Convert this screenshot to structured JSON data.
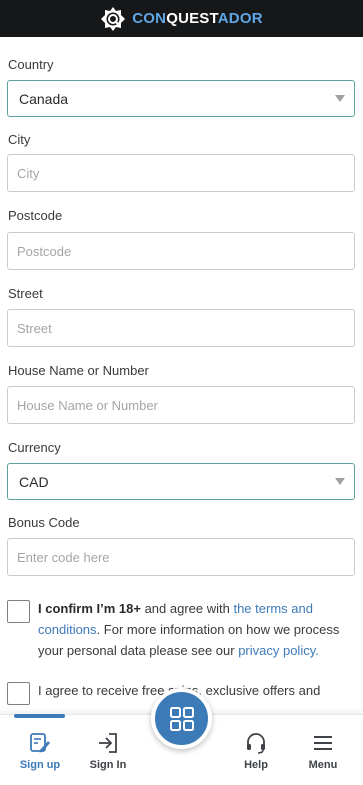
{
  "brand": {
    "logo_con": "CON",
    "logo_quest": "QUEST",
    "logo_ador": "ADOR"
  },
  "form": {
    "country": {
      "label": "Country",
      "value": "Canada"
    },
    "city": {
      "label": "City",
      "placeholder": "City"
    },
    "postcode": {
      "label": "Postcode",
      "placeholder": "Postcode"
    },
    "street": {
      "label": "Street",
      "placeholder": "Street"
    },
    "house": {
      "label": "House Name or Number",
      "placeholder": "House Name or Number"
    },
    "currency": {
      "label": "Currency",
      "value": "CAD"
    },
    "bonus": {
      "label": "Bonus Code",
      "placeholder": "Enter code here"
    }
  },
  "consent": {
    "age_bold": "I confirm I’m 18+",
    "age_text_1": " and agree with ",
    "age_link_terms": "the terms and conditions",
    "age_text_2": ". For more information on how we process your personal data please see our ",
    "age_link_privacy": "privacy policy.",
    "marketing_text": "I agree to receive free spins, exclusive offers and"
  },
  "nav": {
    "signup": "Sign up",
    "signin": "Sign In",
    "help": "Help",
    "menu": "Menu"
  },
  "colors": {
    "accent": "#3d7ab8",
    "select_border": "#5ba39a",
    "topbar": "#161718"
  }
}
